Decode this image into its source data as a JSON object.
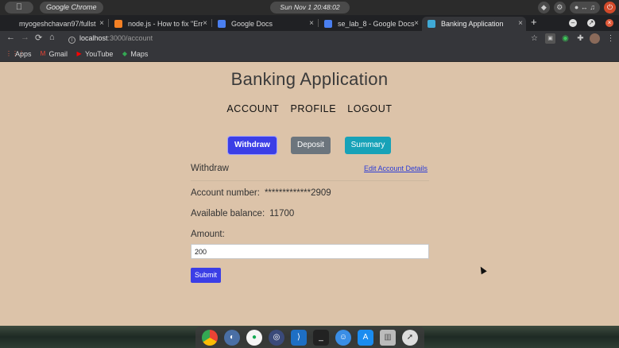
{
  "os": {
    "app_name": "Google Chrome",
    "clock": "Sun Nov 1  20:48:02"
  },
  "browser": {
    "tabs": [
      {
        "label": "myogeshchavan97/fullst"
      },
      {
        "label": "node.js - How to fix \"Err"
      },
      {
        "label": "Google Docs"
      },
      {
        "label": "se_lab_8 - Google Docs"
      },
      {
        "label": "Banking Application"
      }
    ],
    "url_host": "localhost",
    "url_path": ":3000/account",
    "bookmarks": [
      {
        "label": "Apps"
      },
      {
        "label": "Gmail"
      },
      {
        "label": "YouTube"
      },
      {
        "label": "Maps"
      }
    ]
  },
  "page": {
    "title": "Banking Application",
    "nav": {
      "account": "ACCOUNT",
      "profile": "PROFILE",
      "logout": "LOGOUT"
    },
    "buttons": {
      "withdraw": "Withdraw",
      "deposit": "Deposit",
      "summary": "Summary"
    },
    "section_title": "Withdraw",
    "edit_link": "Edit Account Details",
    "account_number_label": "Account number:",
    "account_number_value": "*************2909",
    "balance_label": "Available balance:",
    "balance_value": "11700",
    "amount_label": "Amount:",
    "amount_value": "200",
    "submit_label": "Submit"
  },
  "colors": {
    "page_bg": "#dcc3a9",
    "primary": "#3b3ee6",
    "secondary": "#6c757d",
    "info": "#17a2b8"
  }
}
